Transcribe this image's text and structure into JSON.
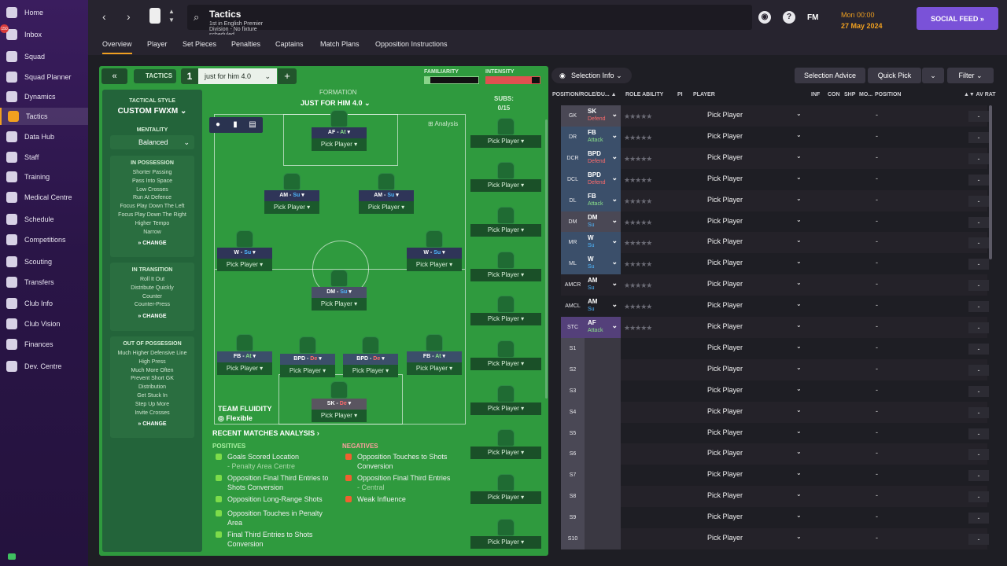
{
  "sidebar": {
    "items": [
      {
        "label": "Home"
      },
      {
        "label": "Inbox"
      },
      {
        "label": "Squad"
      },
      {
        "label": "Squad Planner"
      },
      {
        "label": "Dynamics"
      },
      {
        "label": "Tactics"
      },
      {
        "label": "Data Hub"
      },
      {
        "label": "Staff"
      },
      {
        "label": "Training"
      },
      {
        "label": "Medical Centre"
      },
      {
        "label": "Schedule"
      },
      {
        "label": "Competitions"
      },
      {
        "label": "Scouting"
      },
      {
        "label": "Transfers"
      },
      {
        "label": "Club Info"
      },
      {
        "label": "Club Vision"
      },
      {
        "label": "Finances"
      },
      {
        "label": "Dev. Centre"
      }
    ],
    "inbox_badge": "150"
  },
  "header": {
    "title": "Tactics",
    "subtitle": "1st in English Premier Division - No fixture scheduled.",
    "fm_label": "FM",
    "date_time": "Mon 00:00",
    "date": "27 May 2024",
    "social_feed": "SOCIAL FEED"
  },
  "tabs": [
    {
      "label": "Overview"
    },
    {
      "label": "Player"
    },
    {
      "label": "Set Pieces"
    },
    {
      "label": "Penalties"
    },
    {
      "label": "Captains"
    },
    {
      "label": "Match Plans"
    },
    {
      "label": "Opposition Instructions"
    }
  ],
  "tactic": {
    "tactics_label": "TACTICS",
    "number": "1",
    "name": "just for him 4.0",
    "familiarity_label": "FAMILIARITY",
    "intensity_label": "INTENSITY",
    "familiarity_level": 0.1,
    "intensity_level": 0.85
  },
  "style": {
    "tactical_style_label": "TACTICAL STYLE",
    "tactical_style": "CUSTOM FWXM",
    "mentality_label": "MENTALITY",
    "mentality": "Balanced",
    "in_possession": {
      "title": "IN POSSESSION",
      "lines": [
        "Shorter Passing",
        "Pass Into Space",
        "Low Crosses",
        "Run At Defence",
        "Focus Play Down The Left",
        "Focus Play Down The Right",
        "Higher Tempo",
        "Narrow"
      ],
      "change": "CHANGE"
    },
    "in_transition": {
      "title": "IN TRANSITION",
      "lines": [
        "Roll It Out",
        "Distribute Quickly",
        "Counter",
        "Counter-Press"
      ],
      "change": "CHANGE"
    },
    "out_of_possession": {
      "title": "OUT OF POSSESSION",
      "lines": [
        "Much Higher Defensive Line",
        "High Press",
        "Much More Often",
        "Prevent Short GK",
        "Distribution",
        "Get Stuck In",
        "Step Up More",
        "Invite Crosses"
      ],
      "change": "CHANGE"
    }
  },
  "formation": {
    "label": "FORMATION",
    "name": "JUST FOR HIM 4.0",
    "analysis": "Analysis",
    "subs_label": "SUBS:",
    "subs_count": "0/15",
    "team_fluidity_label": "TEAM FLUIDITY",
    "team_fluidity": "Flexible",
    "pick_player": "Pick Player",
    "players": [
      {
        "role": "AF",
        "duty": "At",
        "duty_class": "att"
      },
      {
        "role": "AM",
        "duty": "Su",
        "duty_class": "r"
      },
      {
        "role": "AM",
        "duty": "Su",
        "duty_class": "r"
      },
      {
        "role": "W",
        "duty": "Su",
        "duty_class": "r"
      },
      {
        "role": "W",
        "duty": "Su",
        "duty_class": "r"
      },
      {
        "role": "DM",
        "duty": "Su",
        "duty_class": "r"
      },
      {
        "role": "FB",
        "duty": "At",
        "duty_class": "att"
      },
      {
        "role": "BPD",
        "duty": "De",
        "duty_class": "def"
      },
      {
        "role": "BPD",
        "duty": "De",
        "duty_class": "def"
      },
      {
        "role": "FB",
        "duty": "At",
        "duty_class": "att"
      },
      {
        "role": "SK",
        "duty": "De",
        "duty_class": "def"
      }
    ]
  },
  "analysis": {
    "title": "RECENT MATCHES ANALYSIS",
    "positives_label": "POSITIVES",
    "negatives_label": "NEGATIVES",
    "positives": [
      {
        "text": "Goals Scored Location",
        "detail": "- Penalty Area Centre"
      },
      {
        "text": "Opposition Final Third Entries to Shots Conversion",
        "detail": ""
      },
      {
        "text": "Opposition Long-Range Shots",
        "detail": ""
      },
      {
        "text": "Opposition Touches in Penalty Area",
        "detail": ""
      },
      {
        "text": "Final Third Entries to Shots Conversion",
        "detail": ""
      }
    ],
    "negatives": [
      {
        "text": "Opposition Touches to Shots Conversion",
        "detail": ""
      },
      {
        "text": "Opposition Final Third Entries",
        "detail": "- Central"
      },
      {
        "text": "Weak Influence",
        "detail": ""
      }
    ]
  },
  "selection": {
    "selection_info": "Selection Info",
    "selection_advice": "Selection Advice",
    "quick_pick": "Quick Pick",
    "filter": "Filter",
    "headers": [
      "POSITION/ROLE/DU...",
      "ROLE ABILITY",
      "PI",
      "PLAYER",
      "INF",
      "CON",
      "SHP",
      "MO...",
      "POSITION",
      "AV RAT"
    ],
    "rows": [
      {
        "pos": "GK",
        "role": "SK",
        "duty": "Defend",
        "dc": "#ff6b6b",
        "bg": "#4a4855"
      },
      {
        "pos": "DR",
        "role": "FB",
        "duty": "Attack",
        "dc": "#8be28b",
        "bg": "#3b4f6a"
      },
      {
        "pos": "DCR",
        "role": "BPD",
        "duty": "Defend",
        "dc": "#ff6b6b",
        "bg": "#3b4f6a"
      },
      {
        "pos": "DCL",
        "role": "BPD",
        "duty": "Defend",
        "dc": "#ff6b6b",
        "bg": "#3b4f6a"
      },
      {
        "pos": "DL",
        "role": "FB",
        "duty": "Attack",
        "dc": "#8be28b",
        "bg": "#3b4f6a"
      },
      {
        "pos": "DM",
        "role": "DM",
        "duty": "Su",
        "dc": "#4fb8ff",
        "bg": "#4a4855"
      },
      {
        "pos": "MR",
        "role": "W",
        "duty": "Su",
        "dc": "#4fb8ff",
        "bg": "#3b4f6a"
      },
      {
        "pos": "ML",
        "role": "W",
        "duty": "Su",
        "dc": "#4fb8ff",
        "bg": "#3b4f6a"
      },
      {
        "pos": "AMCR",
        "role": "AM",
        "duty": "Su",
        "dc": "#4fb8ff",
        "bg": ""
      },
      {
        "pos": "AMCL",
        "role": "AM",
        "duty": "Su",
        "dc": "#4fb8ff",
        "bg": ""
      },
      {
        "pos": "STC",
        "role": "AF",
        "duty": "Attack",
        "dc": "#8be28b",
        "bg": "#54407a"
      },
      {
        "pos": "S1",
        "role": "",
        "duty": "",
        "dc": "",
        "bg": "#4a4855"
      },
      {
        "pos": "S2",
        "role": "",
        "duty": "",
        "dc": "",
        "bg": "#4a4855"
      },
      {
        "pos": "S3",
        "role": "",
        "duty": "",
        "dc": "",
        "bg": "#4a4855"
      },
      {
        "pos": "S4",
        "role": "",
        "duty": "",
        "dc": "",
        "bg": "#4a4855"
      },
      {
        "pos": "S5",
        "role": "",
        "duty": "",
        "dc": "",
        "bg": "#4a4855"
      },
      {
        "pos": "S6",
        "role": "",
        "duty": "",
        "dc": "",
        "bg": "#4a4855"
      },
      {
        "pos": "S7",
        "role": "",
        "duty": "",
        "dc": "",
        "bg": "#4a4855"
      },
      {
        "pos": "S8",
        "role": "",
        "duty": "",
        "dc": "",
        "bg": "#4a4855"
      },
      {
        "pos": "S9",
        "role": "",
        "duty": "",
        "dc": "",
        "bg": "#4a4855"
      },
      {
        "pos": "S10",
        "role": "",
        "duty": "",
        "dc": "",
        "bg": "#4a4855"
      }
    ],
    "pick_player": "Pick Player",
    "dash": "-"
  },
  "colors": {
    "accent": "#f0a020",
    "pitch": "#2f9a3e",
    "social": "#7a52d8"
  }
}
